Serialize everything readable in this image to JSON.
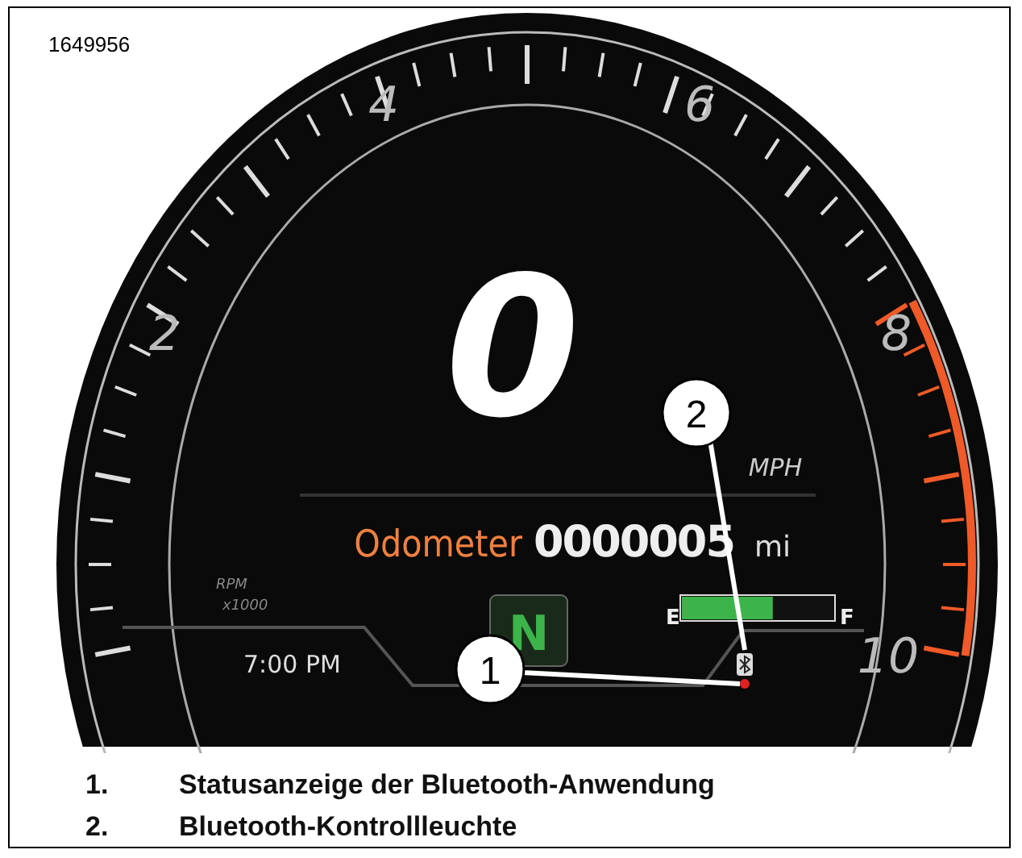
{
  "figure_id": "1649956",
  "tachometer": {
    "labels": [
      "2",
      "4",
      "6",
      "8",
      "10"
    ],
    "unit": "RPM",
    "multiplier": "x1000"
  },
  "speed": {
    "value": "0",
    "unit": "MPH"
  },
  "odometer": {
    "label": "Odometer",
    "value": "0000005",
    "unit": "mi"
  },
  "fuel": {
    "empty": "E",
    "full": "F",
    "level": 0.6
  },
  "clock": "7:00 PM",
  "gear": "N",
  "callouts": [
    {
      "number": "1"
    },
    {
      "number": "2"
    }
  ],
  "legend": [
    {
      "number": "1.",
      "text": "Statusanzeige der Bluetooth-Anwendung"
    },
    {
      "number": "2.",
      "text": "Bluetooth-Kontrollleuchte"
    }
  ]
}
